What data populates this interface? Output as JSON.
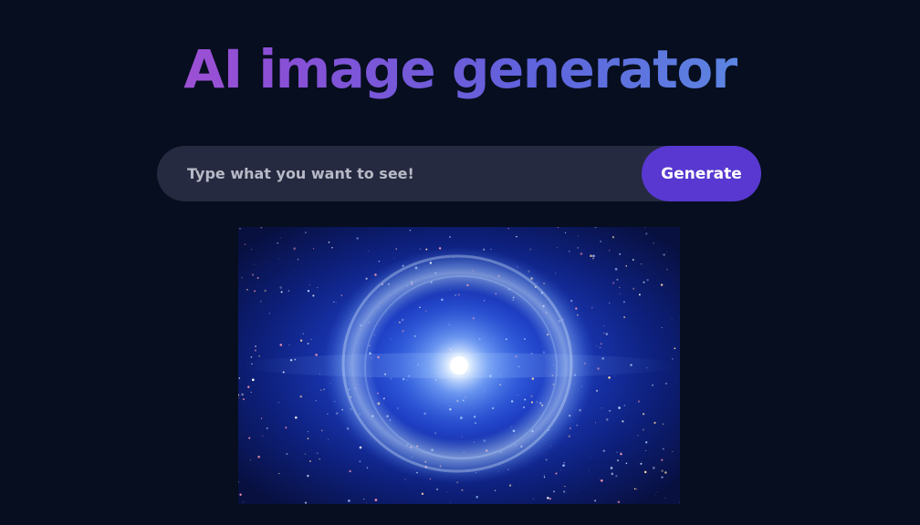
{
  "header": {
    "title": "AI image generator"
  },
  "prompt": {
    "placeholder": "Type what you want to see!",
    "value": ""
  },
  "actions": {
    "generate_label": "Generate"
  },
  "result": {
    "alt": "Generated image: bright blue cosmic explosion"
  },
  "colors": {
    "background": "#060e1f",
    "input_background": "#262a40",
    "button_background": "#5838d0",
    "title_gradient_start": "#c254d0",
    "title_gradient_end": "#5aa2e6"
  }
}
